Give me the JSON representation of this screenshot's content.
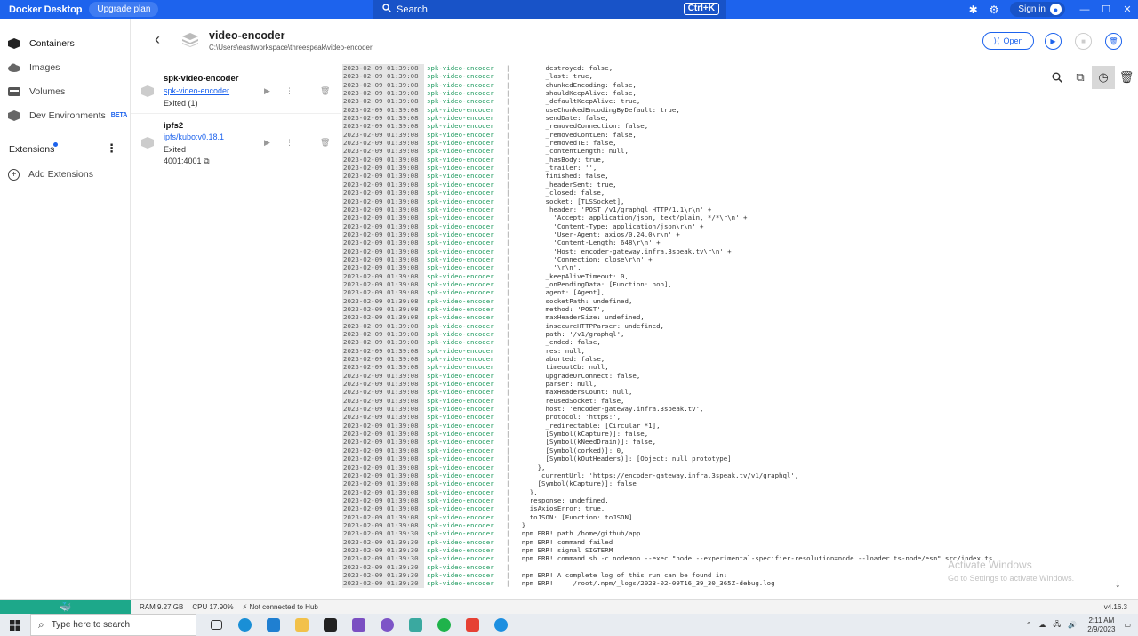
{
  "titlebar": {
    "app_name": "Docker Desktop",
    "upgrade_label": "Upgrade plan",
    "search_label": "Search",
    "search_shortcut": "Ctrl+K",
    "signin_label": "Sign in"
  },
  "sidebar": {
    "items": [
      {
        "label": "Containers",
        "icon": "container-icon"
      },
      {
        "label": "Images",
        "icon": "cloud-icon"
      },
      {
        "label": "Volumes",
        "icon": "volume-icon"
      },
      {
        "label": "Dev Environments",
        "icon": "dev-env-icon",
        "badge": "BETA"
      }
    ],
    "extensions_label": "Extensions",
    "add_extensions_label": "Add Extensions"
  },
  "header": {
    "container_name": "video-encoder",
    "container_path": "C:\\Users\\east\\workspace\\threespeak\\video-encoder",
    "open_label": "Open"
  },
  "containers": [
    {
      "name": "spk-video-encoder",
      "image": "spk-video-encoder",
      "status": "Exited (1)",
      "port": ""
    },
    {
      "name": "ipfs2",
      "image": "ipfs/kubo:v0.18.1",
      "status": "Exited",
      "port": "4001:4001"
    }
  ],
  "logs": {
    "service": "spk-video-encoder",
    "lines": [
      [
        "2023-02-09 01:39:08",
        "        destroyed: false,"
      ],
      [
        "2023-02-09 01:39:08",
        "        _last: true,"
      ],
      [
        "2023-02-09 01:39:08",
        "        chunkedEncoding: false,"
      ],
      [
        "2023-02-09 01:39:08",
        "        shouldKeepAlive: false,"
      ],
      [
        "2023-02-09 01:39:08",
        "        _defaultKeepAlive: true,"
      ],
      [
        "2023-02-09 01:39:08",
        "        useChunkedEncodingByDefault: true,"
      ],
      [
        "2023-02-09 01:39:08",
        "        sendDate: false,"
      ],
      [
        "2023-02-09 01:39:08",
        "        _removedConnection: false,"
      ],
      [
        "2023-02-09 01:39:08",
        "        _removedContLen: false,"
      ],
      [
        "2023-02-09 01:39:08",
        "        _removedTE: false,"
      ],
      [
        "2023-02-09 01:39:08",
        "        _contentLength: null,"
      ],
      [
        "2023-02-09 01:39:08",
        "        _hasBody: true,"
      ],
      [
        "2023-02-09 01:39:08",
        "        _trailer: '',"
      ],
      [
        "2023-02-09 01:39:08",
        "        finished: false,"
      ],
      [
        "2023-02-09 01:39:08",
        "        _headerSent: true,"
      ],
      [
        "2023-02-09 01:39:08",
        "        _closed: false,"
      ],
      [
        "2023-02-09 01:39:08",
        "        socket: [TLSSocket],"
      ],
      [
        "2023-02-09 01:39:08",
        "        _header: 'POST /v1/graphql HTTP/1.1\\r\\n' +"
      ],
      [
        "2023-02-09 01:39:08",
        "          'Accept: application/json, text/plain, */*\\r\\n' +"
      ],
      [
        "2023-02-09 01:39:08",
        "          'Content-Type: application/json\\r\\n' +"
      ],
      [
        "2023-02-09 01:39:08",
        "          'User-Agent: axios/0.24.0\\r\\n' +"
      ],
      [
        "2023-02-09 01:39:08",
        "          'Content-Length: 648\\r\\n' +"
      ],
      [
        "2023-02-09 01:39:08",
        "          'Host: encoder-gateway.infra.3speak.tv\\r\\n' +"
      ],
      [
        "2023-02-09 01:39:08",
        "          'Connection: close\\r\\n' +"
      ],
      [
        "2023-02-09 01:39:08",
        "          '\\r\\n',"
      ],
      [
        "2023-02-09 01:39:08",
        "        _keepAliveTimeout: 0,"
      ],
      [
        "2023-02-09 01:39:08",
        "        _onPendingData: [Function: nop],"
      ],
      [
        "2023-02-09 01:39:08",
        "        agent: [Agent],"
      ],
      [
        "2023-02-09 01:39:08",
        "        socketPath: undefined,"
      ],
      [
        "2023-02-09 01:39:08",
        "        method: 'POST',"
      ],
      [
        "2023-02-09 01:39:08",
        "        maxHeaderSize: undefined,"
      ],
      [
        "2023-02-09 01:39:08",
        "        insecureHTTPParser: undefined,"
      ],
      [
        "2023-02-09 01:39:08",
        "        path: '/v1/graphql',"
      ],
      [
        "2023-02-09 01:39:08",
        "        _ended: false,"
      ],
      [
        "2023-02-09 01:39:08",
        "        res: null,"
      ],
      [
        "2023-02-09 01:39:08",
        "        aborted: false,"
      ],
      [
        "2023-02-09 01:39:08",
        "        timeoutCb: null,"
      ],
      [
        "2023-02-09 01:39:08",
        "        upgradeOrConnect: false,"
      ],
      [
        "2023-02-09 01:39:08",
        "        parser: null,"
      ],
      [
        "2023-02-09 01:39:08",
        "        maxHeadersCount: null,"
      ],
      [
        "2023-02-09 01:39:08",
        "        reusedSocket: false,"
      ],
      [
        "2023-02-09 01:39:08",
        "        host: 'encoder-gateway.infra.3speak.tv',"
      ],
      [
        "2023-02-09 01:39:08",
        "        protocol: 'https:',"
      ],
      [
        "2023-02-09 01:39:08",
        "        _redirectable: [Circular *1],"
      ],
      [
        "2023-02-09 01:39:08",
        "        [Symbol(kCapture)]: false,"
      ],
      [
        "2023-02-09 01:39:08",
        "        [Symbol(kNeedDrain)]: false,"
      ],
      [
        "2023-02-09 01:39:08",
        "        [Symbol(corked)]: 0,"
      ],
      [
        "2023-02-09 01:39:08",
        "        [Symbol(kOutHeaders)]: [Object: null prototype]"
      ],
      [
        "2023-02-09 01:39:08",
        "      },"
      ],
      [
        "2023-02-09 01:39:08",
        "      _currentUrl: 'https://encoder-gateway.infra.3speak.tv/v1/graphql',"
      ],
      [
        "2023-02-09 01:39:08",
        "      [Symbol(kCapture)]: false"
      ],
      [
        "2023-02-09 01:39:08",
        "    },"
      ],
      [
        "2023-02-09 01:39:08",
        "    response: undefined,"
      ],
      [
        "2023-02-09 01:39:08",
        "    isAxiosError: true,"
      ],
      [
        "2023-02-09 01:39:08",
        "    toJSON: [Function: toJSON]"
      ],
      [
        "2023-02-09 01:39:08",
        "  }"
      ],
      [
        "2023-02-09 01:39:30",
        "  npm ERR! path /home/github/app"
      ],
      [
        "2023-02-09 01:39:30",
        "  npm ERR! command failed"
      ],
      [
        "2023-02-09 01:39:30",
        "  npm ERR! signal SIGTERM"
      ],
      [
        "2023-02-09 01:39:30",
        "  npm ERR! command sh -c nodemon --exec \"node --experimental-specifier-resolution=node --loader ts-node/esm\" src/index.ts"
      ],
      [
        "2023-02-09 01:39:30",
        "  "
      ],
      [
        "2023-02-09 01:39:30",
        "  npm ERR! A complete log of this run can be found in:"
      ],
      [
        "2023-02-09 01:39:30",
        "  npm ERR!     /root/.npm/_logs/2023-02-09T16_39_30_365Z-debug.log"
      ]
    ]
  },
  "watermark": {
    "title": "Activate Windows",
    "subtitle": "Go to Settings to activate Windows."
  },
  "statusbar": {
    "ram": "RAM 9.27 GB",
    "cpu": "CPU 17.90%",
    "hub": "Not connected to Hub",
    "version": "v4.16.3"
  },
  "taskbar": {
    "search_placeholder": "Type here to search",
    "time": "2:11 AM",
    "date": "2/9/2023"
  }
}
